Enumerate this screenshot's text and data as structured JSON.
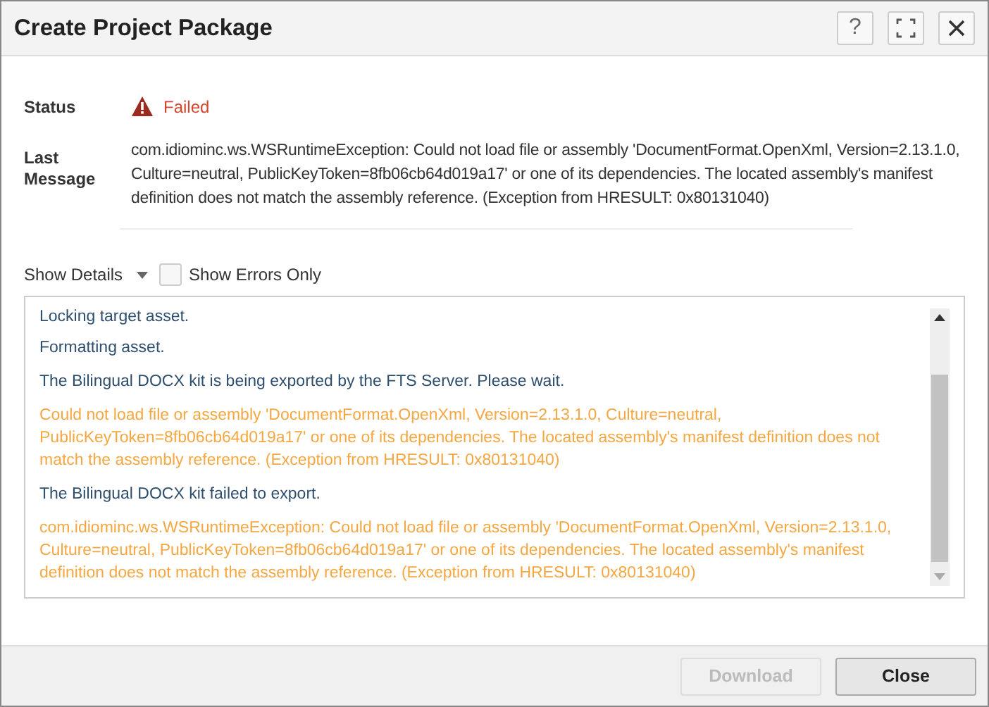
{
  "window": {
    "title": "Create Project Package",
    "buttons": [
      {
        "kind": "help",
        "label": "?"
      },
      {
        "kind": "maximize"
      },
      {
        "kind": "close"
      }
    ]
  },
  "status": {
    "label": "Status",
    "value": "Failed"
  },
  "last_message": {
    "label": "Last Message",
    "text": "com.idiominc.ws.WSRuntimeException: Could not load file or assembly 'DocumentFormat.OpenXml, Version=2.13.1.0, Culture=neutral, PublicKeyToken=8fb06cb64d019a17' or one of its dependencies. The located assembly's manifest definition does not match the assembly reference. (Exception from HRESULT: 0x80131040)"
  },
  "details": {
    "label": "Show Details",
    "errors_only": {
      "label": "Show Errors Only",
      "checked": false
    }
  },
  "log": [
    {
      "kind": "info",
      "text": "Locking target asset."
    },
    {
      "kind": "info",
      "text": "Formatting asset."
    },
    {
      "kind": "info",
      "text": "The Bilingual DOCX kit is being exported by the FTS Server. Please wait."
    },
    {
      "kind": "error",
      "text": "Could not load file or assembly 'DocumentFormat.OpenXml, Version=2.13.1.0, Culture=neutral, PublicKeyToken=8fb06cb64d019a17' or one of its dependencies. The located assembly's manifest definition does not match the assembly reference. (Exception from HRESULT: 0x80131040)"
    },
    {
      "kind": "info",
      "text": "The Bilingual DOCX kit failed to export."
    },
    {
      "kind": "error",
      "text": "com.idiominc.ws.WSRuntimeException: Could not load file or assembly 'DocumentFormat.OpenXml, Version=2.13.1.0, Culture=neutral, PublicKeyToken=8fb06cb64d019a17' or one of its dependencies. The located assembly's manifest definition does not match the assembly reference. (Exception from HRESULT: 0x80131040)"
    }
  ],
  "footer_buttons": [
    {
      "label": "Download",
      "disabled": true
    },
    {
      "label": "Close",
      "disabled": false
    }
  ]
}
